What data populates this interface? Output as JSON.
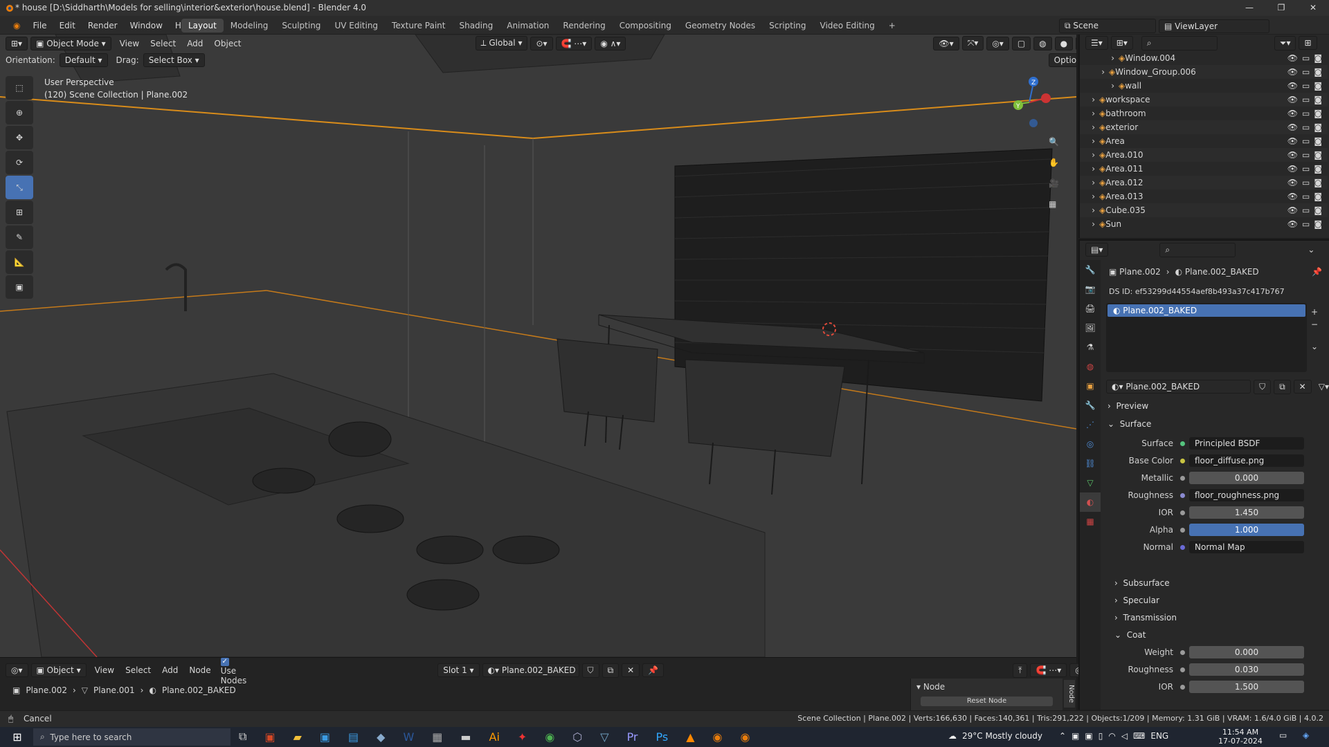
{
  "window": {
    "title": "* house [D:\\Siddharth\\Models for selling\\interior&exterior\\house.blend] - Blender 4.0"
  },
  "menu": [
    "File",
    "Edit",
    "Render",
    "Window",
    "Help"
  ],
  "workspace_tabs": [
    "Layout",
    "Modeling",
    "Sculpting",
    "UV Editing",
    "Texture Paint",
    "Shading",
    "Animation",
    "Rendering",
    "Compositing",
    "Geometry Nodes",
    "Scripting",
    "Video Editing"
  ],
  "active_tab": "Layout",
  "scene": {
    "label": "Scene",
    "view_layer": "ViewLayer"
  },
  "viewport": {
    "mode": "Object Mode",
    "menus": [
      "View",
      "Select",
      "Add",
      "Object"
    ],
    "transform_orientation": "Global",
    "orientation_label": "Orientation:",
    "orientation_value": "Default",
    "drag_label": "Drag:",
    "drag_value": "Select Box",
    "options": "Options",
    "perspective": "User Perspective",
    "collection_info": "(120) Scene Collection | Plane.002"
  },
  "outliner": {
    "rows": [
      {
        "name": "Window.004",
        "indent": 3
      },
      {
        "name": "Window_Group.006",
        "indent": 2
      },
      {
        "name": "wall",
        "indent": 3
      },
      {
        "name": "workspace",
        "indent": 1
      },
      {
        "name": "bathroom",
        "indent": 1
      },
      {
        "name": "exterior",
        "indent": 1
      },
      {
        "name": "Area",
        "indent": 1
      },
      {
        "name": "Area.010",
        "indent": 1
      },
      {
        "name": "Area.011",
        "indent": 1
      },
      {
        "name": "Area.012",
        "indent": 1
      },
      {
        "name": "Area.013",
        "indent": 1
      },
      {
        "name": "Cube.035",
        "indent": 1
      },
      {
        "name": "Sun",
        "indent": 1
      }
    ]
  },
  "properties": {
    "breadcrumb_object": "Plane.002",
    "breadcrumb_material": "Plane.002_BAKED",
    "ds_id": "DS ID: ef53299d44554aef8b493a37c417b767",
    "slot_material": "Plane.002_BAKED",
    "material_name": "Plane.002_BAKED",
    "sections": {
      "preview": "Preview",
      "surface": "Surface",
      "subsurface": "Subsurface",
      "specular": "Specular",
      "transmission": "Transmission",
      "coat": "Coat"
    },
    "fields": [
      {
        "label": "Surface",
        "value": "Principled BSDF",
        "kind": "link",
        "dot": "#55c47e"
      },
      {
        "label": "Base Color",
        "value": "floor_diffuse.png",
        "kind": "link",
        "dot": "#c9c442"
      },
      {
        "label": "Metallic",
        "value": "0.000",
        "kind": "num"
      },
      {
        "label": "Roughness",
        "value": "floor_roughness.png",
        "kind": "link",
        "dot": "#8a8ad0"
      },
      {
        "label": "IOR",
        "value": "1.450",
        "kind": "num"
      },
      {
        "label": "Alpha",
        "value": "1.000",
        "kind": "numblue"
      },
      {
        "label": "Normal",
        "value": "Normal Map",
        "kind": "link",
        "dot": "#6b6bd6"
      }
    ],
    "coat_fields": [
      {
        "label": "Weight",
        "value": "0.000"
      },
      {
        "label": "Roughness",
        "value": "0.030"
      },
      {
        "label": "IOR",
        "value": "1.500"
      }
    ]
  },
  "node_editor": {
    "type": "Object",
    "menus": [
      "View",
      "Select",
      "Add",
      "Node"
    ],
    "use_nodes": "Use Nodes",
    "slot": "Slot 1",
    "material": "Plane.002_BAKED",
    "breadcrumb": [
      "Plane.002",
      "Plane.001",
      "Plane.002_BAKED"
    ],
    "panel_title": "Node",
    "panel_tab": "Node",
    "reset_node": "Reset Node"
  },
  "status": {
    "left": "Cancel",
    "right": "Scene Collection | Plane.002 | Verts:166,630 | Faces:140,361 | Tris:291,222 | Objects:1/209 | Memory: 1.31 GiB | VRAM: 1.6/4.0 GiB | 4.0.2"
  },
  "taskbar": {
    "search_placeholder": "Type here to search",
    "weather": "29°C  Mostly cloudy",
    "lang": "ENG",
    "time": "11:54 AM",
    "date": "17-07-2024"
  }
}
